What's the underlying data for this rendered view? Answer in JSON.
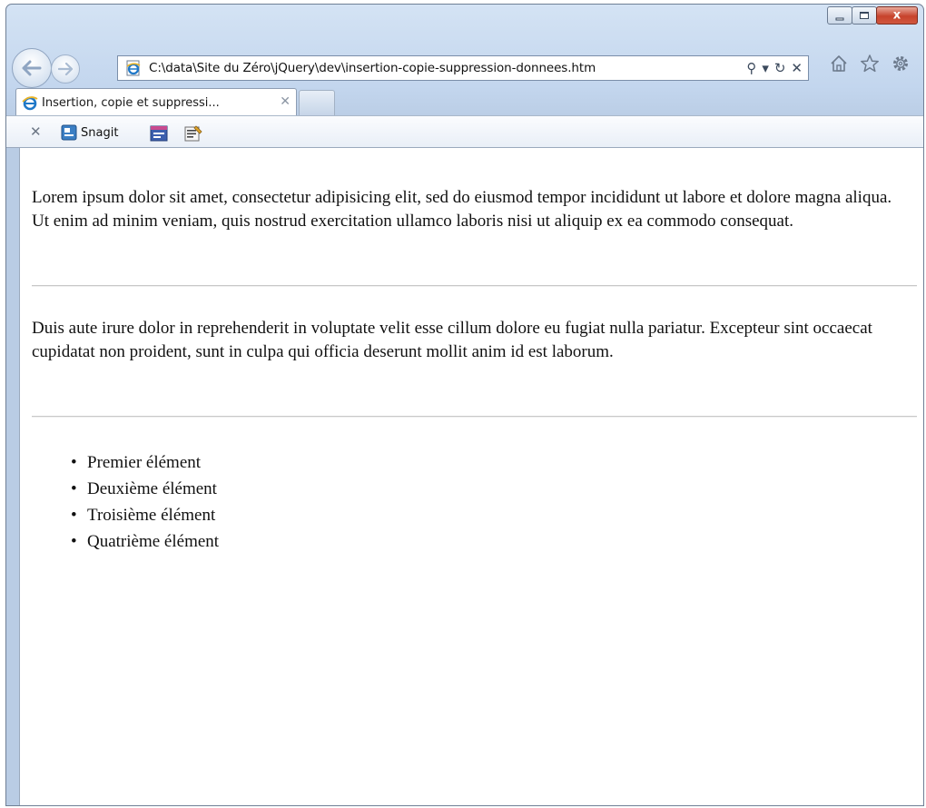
{
  "browser": {
    "address": "C:\\data\\Site du Zéro\\jQuery\\dev\\insertion-copie-suppression-donnees.htm",
    "tab_title": "Insertion, copie et suppressi...",
    "tab_close_glyph": "✕",
    "close_glyph": "x",
    "address_search_glyph": "⚲",
    "address_dropdown_glyph": "▾",
    "address_refresh_glyph": "↻",
    "address_stop_glyph": "✕",
    "icons": [
      "back-icon",
      "forward-icon",
      "home-icon",
      "favorites-icon",
      "tools-icon"
    ]
  },
  "toolbar": {
    "close_glyph": "✕",
    "snagit_label": "Snagit"
  },
  "page": {
    "paragraph1": "Lorem ipsum dolor sit amet, consectetur adipisicing elit, sed do eiusmod tempor incididunt ut labore et dolore magna aliqua. Ut enim ad minim veniam, quis nostrud exercitation ullamco laboris nisi ut aliquip ex ea commodo consequat.",
    "paragraph2": "Duis aute irure dolor in reprehenderit in voluptate velit esse cillum dolore eu fugiat nulla pariatur. Excepteur sint occaecat cupidatat non proident, sunt in culpa qui officia deserunt mollit anim id est laborum.",
    "bullet_glyph": "•",
    "list": [
      "Premier élément",
      "Deuxième élément",
      "Troisième élément",
      "Quatrième élément"
    ]
  },
  "colors": {
    "chrome": "#c3d6ee",
    "close_button": "#c7432c",
    "ie_logo": "#1f78c8"
  }
}
